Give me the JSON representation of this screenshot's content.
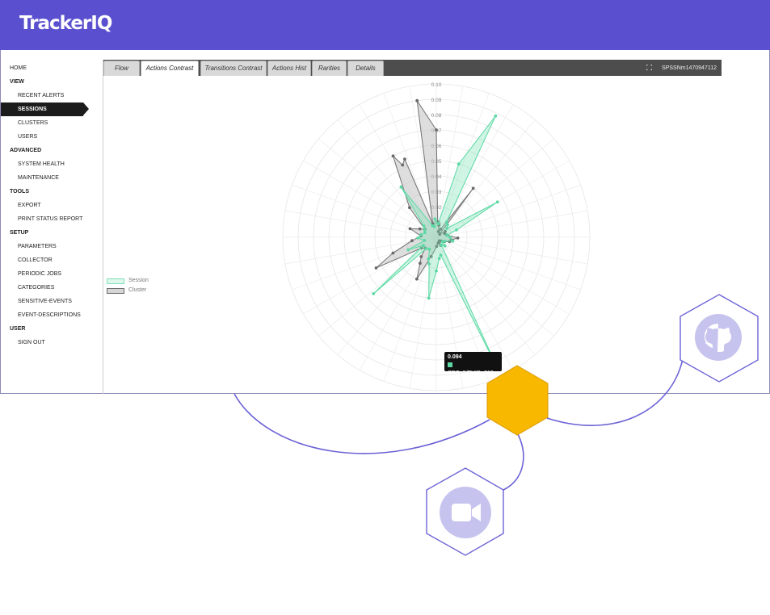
{
  "brand": {
    "logo_text": "TrackerIQ",
    "header_color": "#5a50cf"
  },
  "sidebar": {
    "items": [
      {
        "label": "HOME",
        "type": "link"
      },
      {
        "label": "VIEW",
        "type": "section"
      },
      {
        "label": "RECENT ALERTS",
        "type": "sub"
      },
      {
        "label": "SESSIONS",
        "type": "sub",
        "active": true
      },
      {
        "label": "CLUSTERS",
        "type": "sub"
      },
      {
        "label": "USERS",
        "type": "sub"
      },
      {
        "label": "ADVANCED",
        "type": "section"
      },
      {
        "label": "SYSTEM HEALTH",
        "type": "sub"
      },
      {
        "label": "MAINTENANCE",
        "type": "sub"
      },
      {
        "label": "TOOLS",
        "type": "section"
      },
      {
        "label": "EXPORT",
        "type": "sub"
      },
      {
        "label": "PRINT STATUS REPORT",
        "type": "sub"
      },
      {
        "label": "SETUP",
        "type": "section"
      },
      {
        "label": "PARAMETERS",
        "type": "sub"
      },
      {
        "label": "COLLECTOR",
        "type": "sub"
      },
      {
        "label": "PERIODIC JOBS",
        "type": "sub"
      },
      {
        "label": "CATEGORIES",
        "type": "sub"
      },
      {
        "label": "SENSITIVE-EVENTS",
        "type": "sub"
      },
      {
        "label": "EVENT-DESCRIPTIONS",
        "type": "sub"
      },
      {
        "label": "USER",
        "type": "section"
      },
      {
        "label": "SIGN OUT",
        "type": "sub"
      }
    ]
  },
  "tabs": [
    {
      "label": "Flow"
    },
    {
      "label": "Actions Contrast",
      "active": true
    },
    {
      "label": "Transitions Contrast"
    },
    {
      "label": "Actions Hist"
    },
    {
      "label": "Rarities"
    },
    {
      "label": "Details"
    }
  ],
  "session_id": "SPSSNm1470947112",
  "legend": {
    "session": "Session",
    "cluster": "Cluster"
  },
  "tooltip": {
    "value": "0.094",
    "label": "SRC=5/EVID=313"
  },
  "colors": {
    "session": "#5dd8a5",
    "cluster": "#777777",
    "cluster_fill": "#d6d6d6",
    "accent": "#f9b800",
    "deco_line": "#6c63d6",
    "icon": "#c6c4ee"
  },
  "icons": {
    "top_right": "github-icon",
    "bottom": "video-camera-icon",
    "center": "hexagon-icon"
  },
  "chart_data": {
    "type": "radar",
    "rmax": 0.1,
    "ticks": [
      "0.10",
      "0.09",
      "0.08",
      "0.07",
      "0.06",
      "0.05",
      "0.04",
      "0.03",
      "0.02",
      "0.01"
    ],
    "series": [
      {
        "name": "Cluster",
        "points": [
          [
            0,
            0.07
          ],
          [
            5,
            0.01
          ],
          [
            12,
            0.008
          ],
          [
            20,
            0.004
          ],
          [
            28,
            0.006
          ],
          [
            37,
            0.04
          ],
          [
            48,
            0.003
          ],
          [
            56,
            0.007
          ],
          [
            65,
            0.006
          ],
          [
            78,
            0.007
          ],
          [
            92,
            0.014
          ],
          [
            100,
            0.01
          ],
          [
            108,
            0.009
          ],
          [
            118,
            0.006
          ],
          [
            128,
            0.004
          ],
          [
            140,
            0.003
          ],
          [
            152,
            0.006
          ],
          [
            162,
            0.004
          ],
          [
            178,
            0.006
          ],
          [
            195,
            0.013
          ],
          [
            205,
            0.03
          ],
          [
            212,
            0.02
          ],
          [
            218,
            0.016
          ],
          [
            225,
            0.01
          ],
          [
            234,
            0.012
          ],
          [
            243,
            0.044
          ],
          [
            250,
            0.03
          ],
          [
            262,
            0.016
          ],
          [
            275,
            0.01
          ],
          [
            288,
            0.018
          ],
          [
            297,
            0.012
          ],
          [
            305,
            0.009
          ],
          [
            318,
            0.026
          ],
          [
            332,
            0.06
          ],
          [
            335,
            0.052
          ],
          [
            338,
            0.055
          ],
          [
            345,
            0.009
          ],
          [
            352,
            0.09
          ]
        ]
      },
      {
        "name": "Session",
        "points": [
          [
            8,
            0.009
          ],
          [
            17,
            0.05
          ],
          [
            26,
            0.088
          ],
          [
            34,
            0.012
          ],
          [
            42,
            0.011
          ],
          [
            50,
            0.009
          ],
          [
            60,
            0.046
          ],
          [
            70,
            0.014
          ],
          [
            80,
            0.007
          ],
          [
            90,
            0.009
          ],
          [
            103,
            0.011
          ],
          [
            115,
            0.006
          ],
          [
            125,
            0.005
          ],
          [
            135,
            0.008
          ],
          [
            147,
            0.006
          ],
          [
            155,
            0.094
          ],
          [
            166,
            0.012
          ],
          [
            172,
            0.014
          ],
          [
            180,
            0.022
          ],
          [
            187,
            0.04
          ],
          [
            195,
            0.018
          ],
          [
            200,
            0.015
          ],
          [
            210,
            0.009
          ],
          [
            222,
            0.01
          ],
          [
            228,
            0.055
          ],
          [
            238,
            0.01
          ],
          [
            246,
            0.02
          ],
          [
            255,
            0.008
          ],
          [
            268,
            0.012
          ],
          [
            280,
            0.01
          ],
          [
            292,
            0.008
          ],
          [
            302,
            0.009
          ],
          [
            312,
            0.011
          ],
          [
            325,
            0.04
          ],
          [
            342,
            0.008
          ],
          [
            350,
            0.007
          ],
          [
            356,
            0.012
          ]
        ]
      }
    ]
  }
}
